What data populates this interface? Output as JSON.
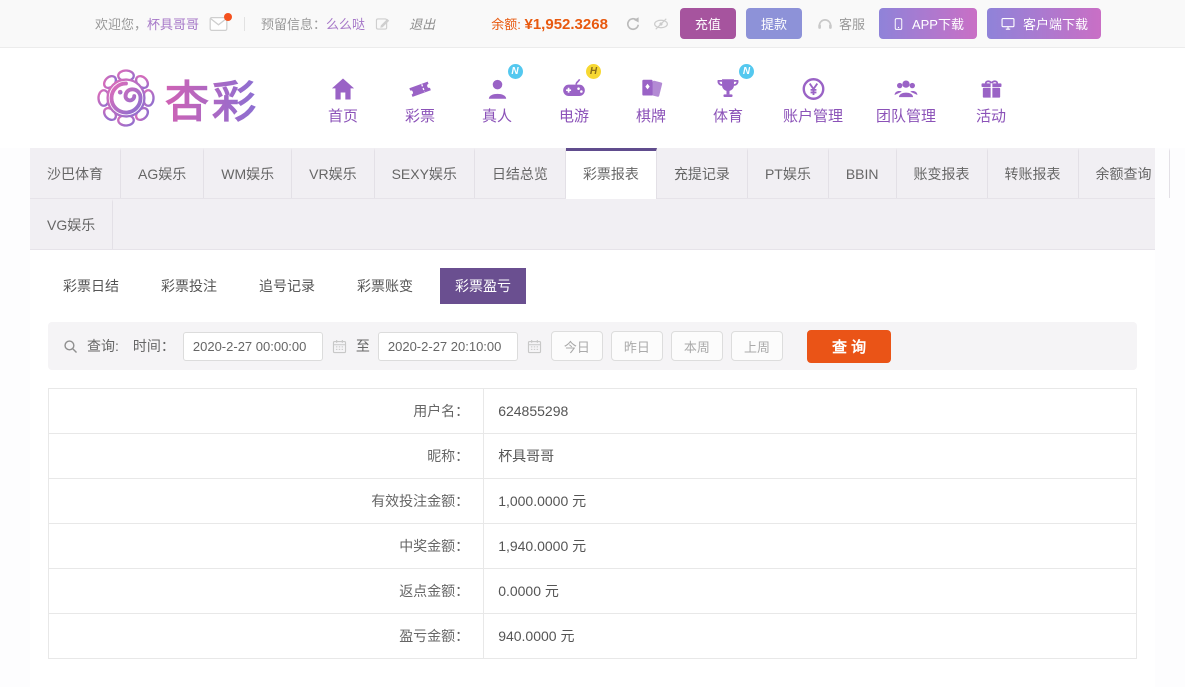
{
  "topbar": {
    "welcome_prefix": "欢迎您，",
    "username": "杯具哥哥",
    "message_label": "预留信息：",
    "message_value": "么么哒",
    "logout": "退出",
    "balance_label": "余额:",
    "balance_value": "¥1,952.3268",
    "recharge": "充值",
    "withdraw": "提款",
    "service": "客服",
    "app_download": "APP下载",
    "client_download": "客户端下载"
  },
  "brand": {
    "name": "杏彩"
  },
  "nav": {
    "items": [
      {
        "label": "首页"
      },
      {
        "label": "彩票"
      },
      {
        "label": "真人",
        "badge": "N"
      },
      {
        "label": "电游",
        "badge": "H"
      },
      {
        "label": "棋牌"
      },
      {
        "label": "体育",
        "badge": "N"
      },
      {
        "label": "账户管理"
      },
      {
        "label": "团队管理"
      },
      {
        "label": "活动"
      }
    ]
  },
  "tabs": {
    "row1": [
      "沙巴体育",
      "AG娱乐",
      "WM娱乐",
      "VR娱乐",
      "SEXY娱乐",
      "日结总览",
      "彩票报表",
      "充提记录",
      "PT娱乐",
      "BBIN",
      "账变报表",
      "转账报表",
      "余额查询"
    ],
    "row2": [
      "VG娱乐"
    ],
    "active": "彩票报表"
  },
  "subtabs": {
    "items": [
      "彩票日结",
      "彩票投注",
      "追号记录",
      "彩票账变",
      "彩票盈亏"
    ],
    "active": "彩票盈亏"
  },
  "query": {
    "label": "查询:",
    "time_label": "时间：",
    "from": "2020-2-27 00:00:00",
    "to_label": "至",
    "to": "2020-2-27 20:10:00",
    "quick": [
      "今日",
      "昨日",
      "本周",
      "上周"
    ],
    "submit": "查 询"
  },
  "table": {
    "rows": [
      {
        "label": "用户名：",
        "value": "624855298"
      },
      {
        "label": "昵称：",
        "value": "杯具哥哥"
      },
      {
        "label": "有效投注金额：",
        "value": "1,000.0000 元"
      },
      {
        "label": "中奖金额：",
        "value": "1,940.0000 元"
      },
      {
        "label": "返点金额：",
        "value": "0.0000 元"
      },
      {
        "label": "盈亏金额：",
        "value": "940.0000 元"
      }
    ]
  },
  "icons": {
    "mail": "envelope",
    "edit": "pencil-square",
    "refresh": "circular-arrow",
    "hide_balance": "eye-slash",
    "service": "headset",
    "app_download": "smartphone",
    "client_download": "monitor",
    "search": "magnifier",
    "calendar": "calendar",
    "nav": [
      "home",
      "ticket",
      "person",
      "gamepad",
      "cards",
      "trophy",
      "yen-coin",
      "group",
      "gift"
    ]
  },
  "colors": {
    "accent_purple": "#604c8d",
    "subtab_active": "#6a4f90",
    "nav_purple": "#8b52b8",
    "balance_orange": "#e8590f",
    "submit_orange": "#ea5417",
    "recharge_btn": "#a6549e",
    "withdraw_btn": "#8d92d8",
    "download_gradient": "#8f83d9 → #c96fc5",
    "badge_n": "#54c8ef",
    "badge_h": "#f7d832"
  }
}
